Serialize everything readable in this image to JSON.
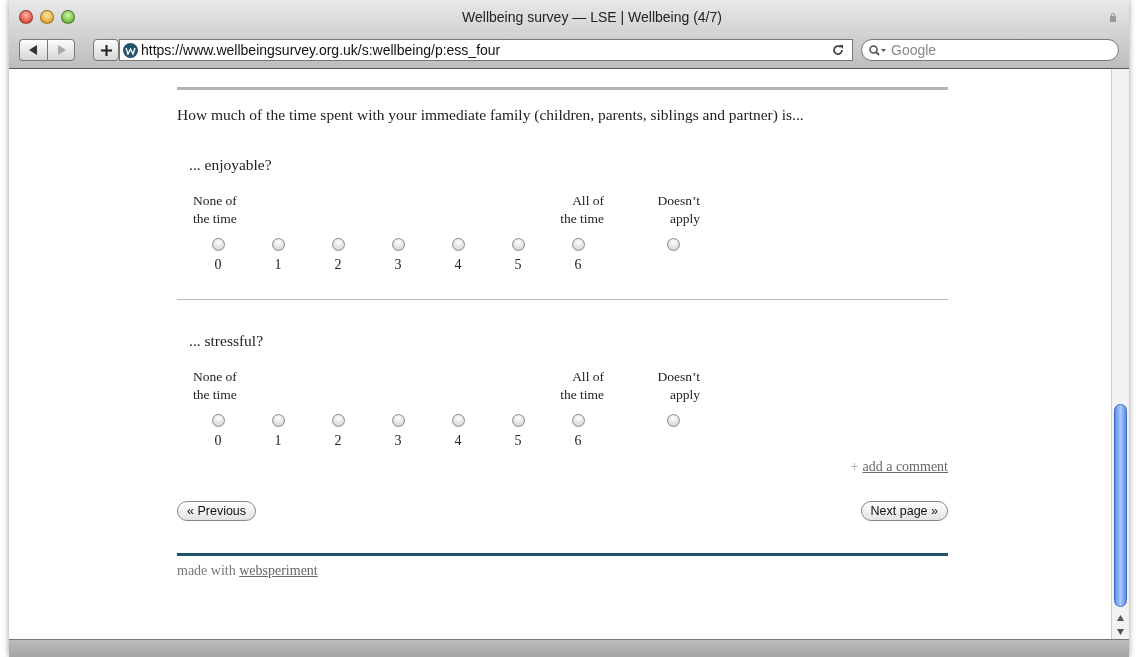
{
  "window": {
    "title": "Wellbeing survey — LSE | Wellbeing (4/7)"
  },
  "toolbar": {
    "url": "https://www.wellbeingsurvey.org.uk/s:wellbeing/p:ess_four",
    "search": {
      "placeholder": "Google"
    }
  },
  "question": "How much of the time spent with your immediate family (children, parents, siblings and partner) is...",
  "items": [
    {
      "prompt": "... enjoyable?",
      "low_label": [
        "None of",
        "the time"
      ],
      "high_label": [
        "All of",
        "the time"
      ],
      "na_label": [
        "Doesn’t",
        "apply"
      ],
      "options": [
        {
          "label": "0",
          "selected": false
        },
        {
          "label": "1",
          "selected": false
        },
        {
          "label": "2",
          "selected": false
        },
        {
          "label": "3",
          "selected": false
        },
        {
          "label": "4",
          "selected": false
        },
        {
          "label": "5",
          "selected": false
        },
        {
          "label": "6",
          "selected": false
        }
      ],
      "na_selected": false
    },
    {
      "prompt": "... stressful?",
      "low_label": [
        "None of",
        "the time"
      ],
      "high_label": [
        "All of",
        "the time"
      ],
      "na_label": [
        "Doesn’t",
        "apply"
      ],
      "options": [
        {
          "label": "0",
          "selected": false
        },
        {
          "label": "1",
          "selected": false
        },
        {
          "label": "2",
          "selected": false
        },
        {
          "label": "3",
          "selected": false
        },
        {
          "label": "4",
          "selected": false
        },
        {
          "label": "5",
          "selected": false
        },
        {
          "label": "6",
          "selected": false
        }
      ],
      "na_selected": false
    }
  ],
  "comment_link": {
    "icon": "+",
    "label": "add a comment"
  },
  "buttons": {
    "previous": "« Previous",
    "next": "Next page »"
  },
  "footer": {
    "text": "made with",
    "link": "websperiment"
  }
}
